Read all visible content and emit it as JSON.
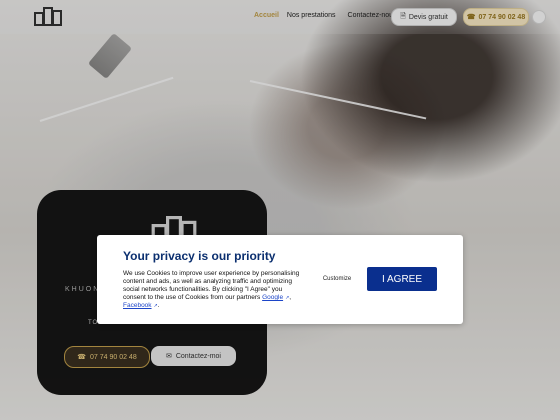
{
  "header": {
    "nav_items": [
      "Accueil",
      "Nos prestations",
      "Contactez-nous"
    ],
    "quote_button": "Devis gratuit",
    "phone_button": "07 74 90 02 48"
  },
  "hero_card": {
    "brand": "KHUON",
    "slogan": "TOUR DE LOCAUX & ENTREPRISES",
    "phone": "07 74 90 02 48",
    "contact": "Contactez-moi"
  },
  "privacy": {
    "title": "Your privacy is our priority",
    "text_intro": "We use Cookies to improve user experience by personalising content and ads, as well as analyzing traffic and optimizing social networks functionalities. By clicking \"I Agree\" you consent to the use of Cookies from our partners",
    "link_google": "Google",
    "link_facebook": "Facebook",
    "customize": "Customize",
    "agree": "I AGREE"
  },
  "colors": {
    "accent": "#c7a34d",
    "modal_title": "#0b2f6f",
    "agree_button": "#0a2f8e"
  }
}
